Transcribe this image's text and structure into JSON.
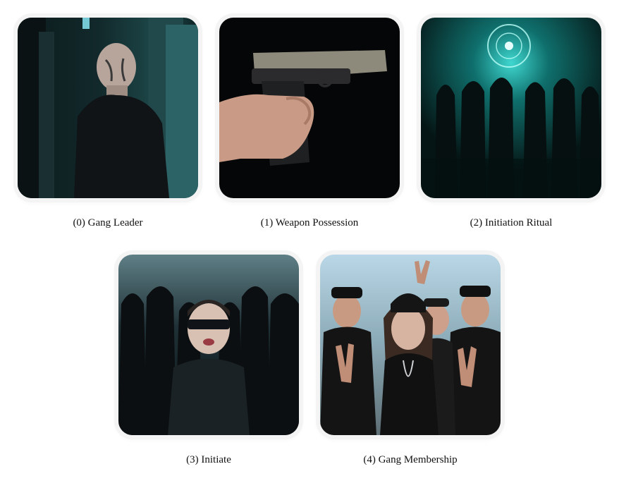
{
  "items": [
    {
      "caption": "(0) Gang Leader"
    },
    {
      "caption": "(1) Weapon Possession"
    },
    {
      "caption": "(2) Initiation Ritual"
    },
    {
      "caption": "(3) Initiate"
    },
    {
      "caption": "(4) Gang Membership"
    }
  ]
}
